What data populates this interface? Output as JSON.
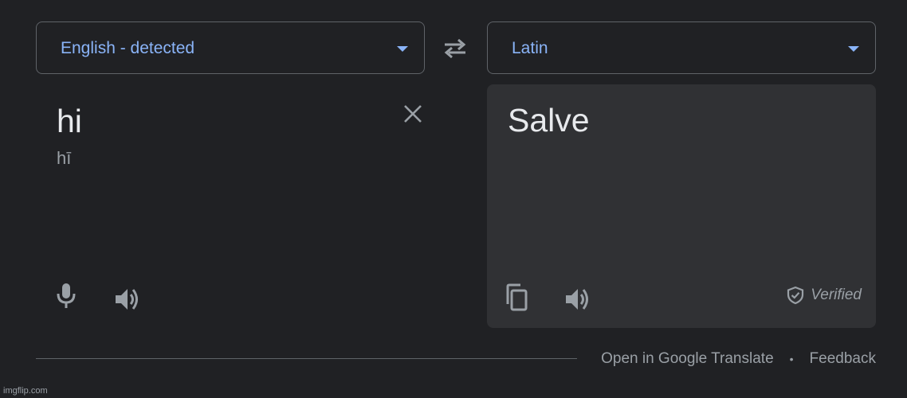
{
  "source_language": {
    "label": "English - detected"
  },
  "target_language": {
    "label": "Latin"
  },
  "source": {
    "text": "hi",
    "transliteration": "hī"
  },
  "result": {
    "text": "Salve",
    "verified_label": "Verified"
  },
  "footer": {
    "open_link": "Open in Google Translate",
    "separator": "•",
    "feedback_link": "Feedback"
  },
  "watermark": "imgflip.com",
  "colors": {
    "background": "#202124",
    "panel": "#303134",
    "accent": "#8ab4f8",
    "muted": "#9aa0a6",
    "text": "#e8eaed",
    "border": "#5f6368"
  },
  "icons": [
    "chevron-down-icon",
    "swap-icon",
    "close-icon",
    "microphone-icon",
    "speaker-icon",
    "copy-icon",
    "verified-shield-icon"
  ]
}
